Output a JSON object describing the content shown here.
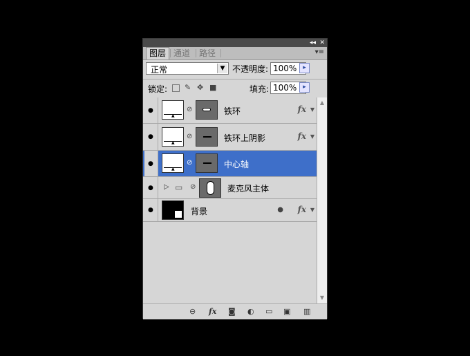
{
  "panel": {
    "collapse_icon": "◂◂",
    "close_icon": "✕",
    "menu_icon": "▾≡"
  },
  "tabs": [
    {
      "label": "图层"
    },
    {
      "label": "通道"
    },
    {
      "label": "路径"
    }
  ],
  "blend_mode": {
    "value": "正常",
    "arrow": "▼"
  },
  "opacity": {
    "label": "不透明度:",
    "value": "100%",
    "arrow": "▸"
  },
  "lock": {
    "label": "锁定:"
  },
  "fill": {
    "label": "填充:",
    "value": "100%",
    "arrow": "▸"
  },
  "layers": [
    {
      "name": "铁环",
      "fx": "fx",
      "selected": false
    },
    {
      "name": "铁环上阴影",
      "fx": "fx",
      "selected": false
    },
    {
      "name": "中心轴",
      "fx": "",
      "selected": true
    },
    {
      "name": "麦克风主体",
      "fx": "",
      "selected": false
    },
    {
      "name": "背景",
      "fx": "fx",
      "selected": false
    }
  ],
  "fx_arrow": "▼",
  "eye_glyph": "●",
  "chain_glyph": "⊘",
  "group_arrow": "▷",
  "folder_glyph": "▭",
  "scroll": {
    "up": "▲",
    "down": "▼"
  }
}
